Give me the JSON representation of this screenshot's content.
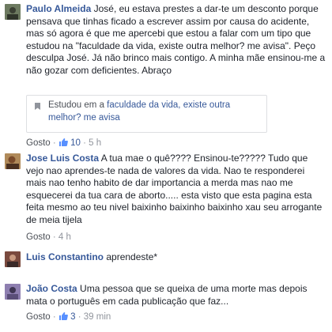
{
  "comments": [
    {
      "author": "Paulo Almeida",
      "text": "José, eu estava prestes a dar-te um desconto porque pensava que tinhas ficado a escrever assim por causa do acidente, mas só agora é que me apercebi que estou a falar com um tipo que estudou na \"faculdade da vida, existe outra melhor? me avisa\". Peço desculpa José. Já não brinco mais contigo. A minha mãe ensinou-me a não gozar com deficientes. Abraço",
      "quote": {
        "icon": "bookmark-icon",
        "prefix": "Estudou em a ",
        "link": "faculdade da vida, existe outra melhor? me avisa"
      },
      "like_label": "Gosto",
      "likes": "10",
      "time": "5 h"
    },
    {
      "author": "Jose Luis Costa",
      "text": "A tua mae o quê???? Ensinou-te????? Tudo que vejo nao aprendes-te nada de valores da vida. Nao te responderei mais nao tenho habito de dar importancia a merda mas nao me esquecerei da tua cara de aborto..... esta visto que esta pagina esta feita mesmo ao teu nivel baixinho baixinho baixinho xau seu arrogante de meia tijela",
      "like_label": "Gosto",
      "time": "4 h"
    },
    {
      "author": "Luis Constantino",
      "text": "aprendeste*"
    },
    {
      "author": "João Costa",
      "text": "Uma pessoa que se queixa de uma morte mas depois mata o português em cada publicação que faz...",
      "like_label": "Gosto",
      "likes": "3",
      "time": "39 min"
    }
  ],
  "colors": {
    "author": "#365899",
    "meta": "#90949c",
    "text": "#1d2129"
  }
}
